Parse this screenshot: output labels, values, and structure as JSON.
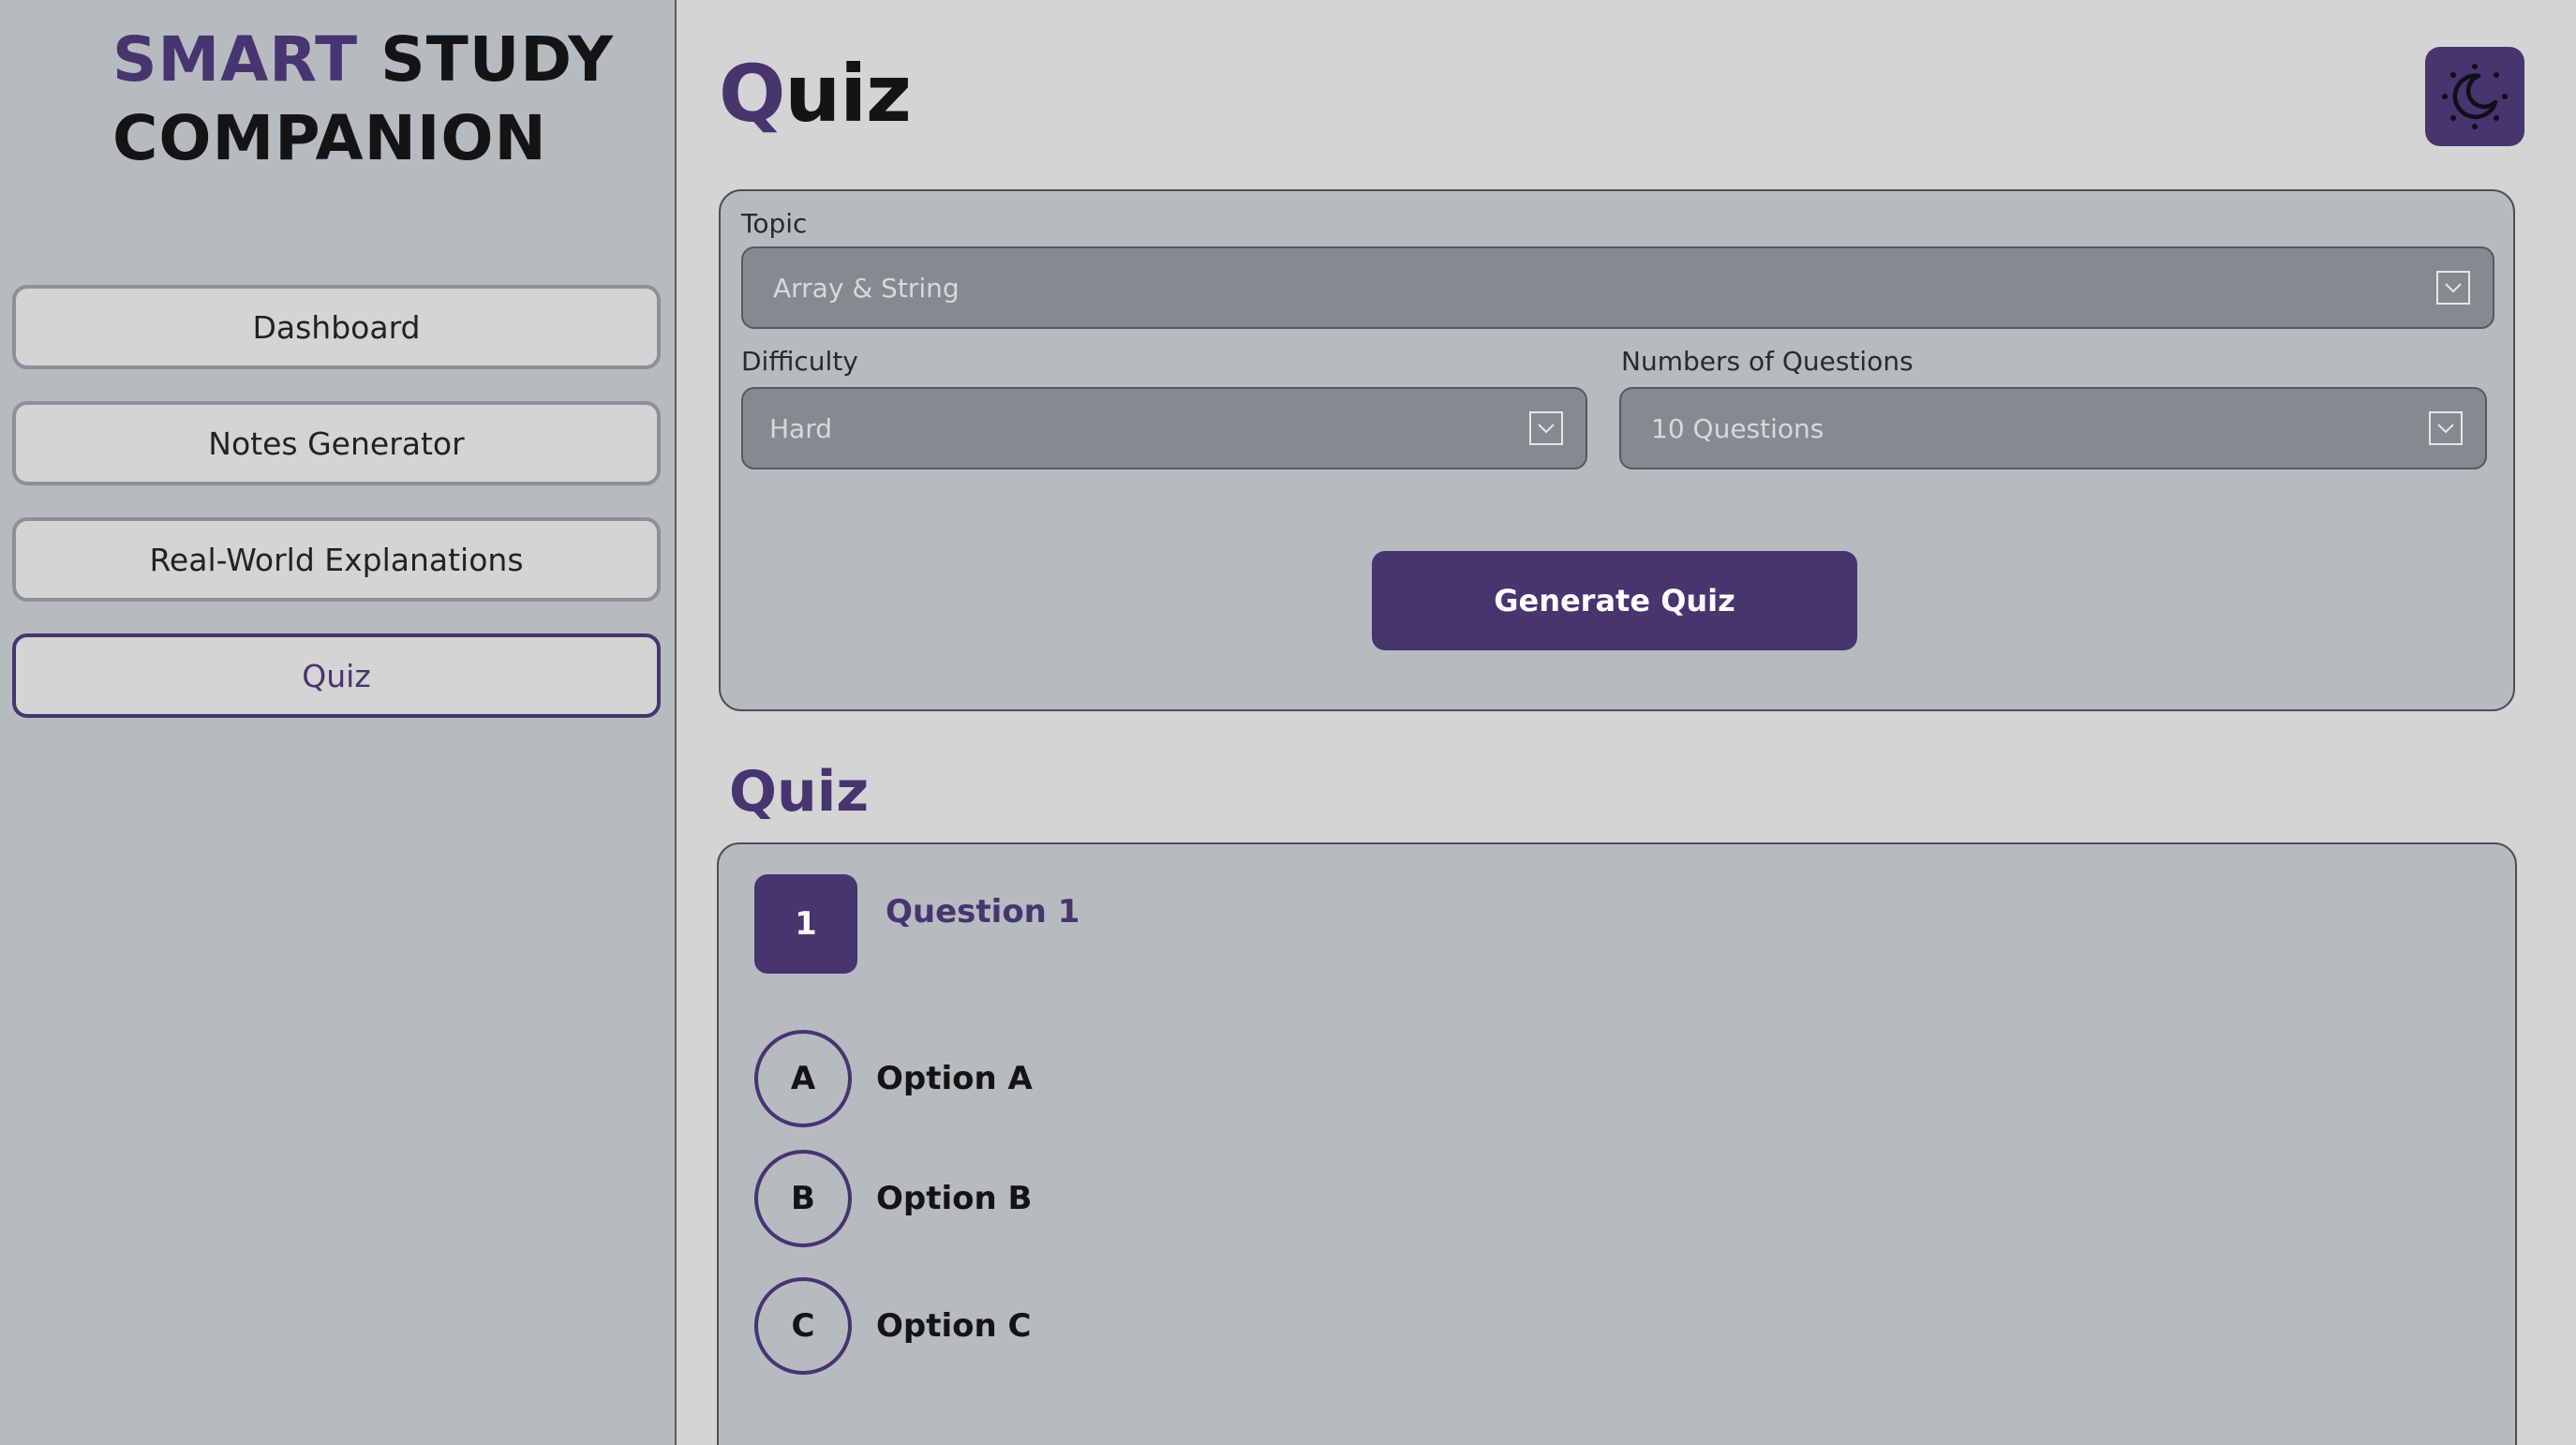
{
  "brand": {
    "accent_word": "SMART",
    "rest_line1": "STUDY",
    "line2": "COMPANION"
  },
  "sidebar": {
    "items": [
      {
        "label": "Dashboard",
        "active": false
      },
      {
        "label": "Notes Generator",
        "active": false
      },
      {
        "label": "Real-World Explanations",
        "active": false
      },
      {
        "label": "Quiz",
        "active": true
      }
    ]
  },
  "header": {
    "title_first": "Q",
    "title_rest": "uiz",
    "theme_icon": "moon-sun-icon"
  },
  "form": {
    "topic_label": "Topic",
    "topic_value": "Array & String",
    "difficulty_label": "Difficulty",
    "difficulty_value": "Hard",
    "count_label": "Numbers of Questions",
    "count_value": "10 Questions",
    "generate_label": "Generate Quiz"
  },
  "quiz": {
    "section_title": "Quiz",
    "question": {
      "number": "1",
      "title": "Question 1"
    },
    "options": [
      {
        "letter": "A",
        "text": "Option A"
      },
      {
        "letter": "B",
        "text": "Option B"
      },
      {
        "letter": "C",
        "text": "Option C"
      }
    ]
  },
  "colors": {
    "accent": "#46356f",
    "sidebar_bg": "#b6bbc0",
    "page_bg": "#d4d4d4",
    "select_bg": "#868a90"
  }
}
